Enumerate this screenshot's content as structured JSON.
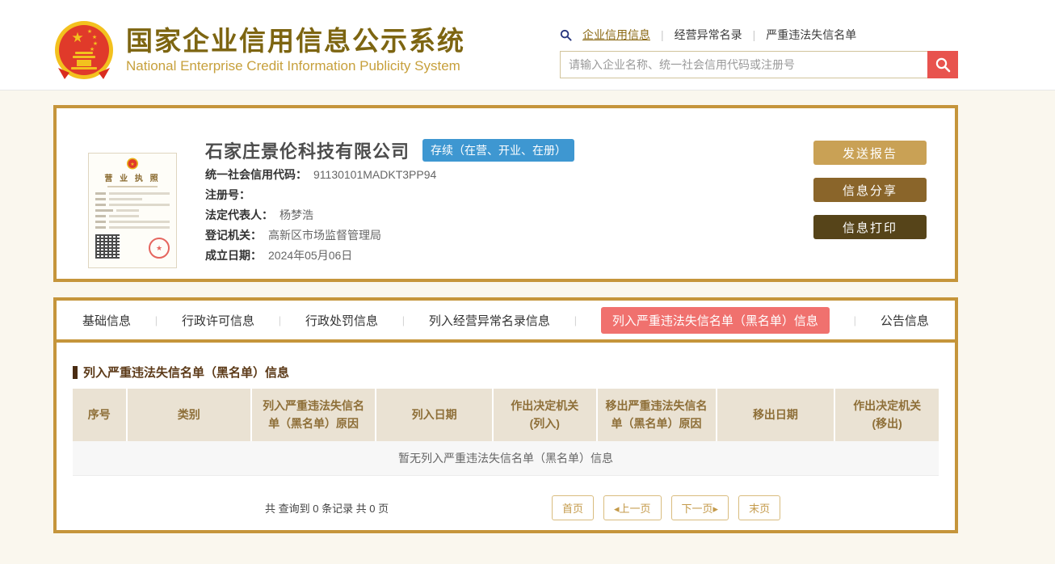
{
  "header": {
    "title_cn": "国家企业信用信息公示系统",
    "title_en": "National Enterprise Credit Information Publicity System",
    "nav": [
      {
        "label": "企业信用信息",
        "active": true
      },
      {
        "label": "经营异常名录",
        "active": false
      },
      {
        "label": "严重违法失信名单",
        "active": false
      }
    ],
    "search": {
      "placeholder": "请输入企业名称、统一社会信用代码或注册号"
    }
  },
  "company": {
    "name": "石家庄景伦科技有限公司",
    "status_badge": "存续（在营、开业、在册）",
    "license_title": "营 业 执 照",
    "fields": [
      {
        "label": "统一社会信用代码：",
        "value": "91130101MADKT3PP94"
      },
      {
        "label": "注册号：",
        "value": ""
      },
      {
        "label": "法定代表人：",
        "value": "杨梦浩"
      },
      {
        "label": "登记机关：",
        "value": "高新区市场监督管理局"
      },
      {
        "label": "成立日期：",
        "value": "2024年05月06日"
      }
    ],
    "actions": [
      {
        "label": "发送报告",
        "color": "#C9A155"
      },
      {
        "label": "信息分享",
        "color": "#8A652A"
      },
      {
        "label": "信息打印",
        "color": "#564419"
      }
    ]
  },
  "tabs": [
    {
      "label": "基础信息",
      "active": false
    },
    {
      "label": "行政许可信息",
      "active": false
    },
    {
      "label": "行政处罚信息",
      "active": false
    },
    {
      "label": "列入经营异常名录信息",
      "active": false
    },
    {
      "label": "列入严重违法失信名单（黑名单）信息",
      "active": true
    },
    {
      "label": "公告信息",
      "active": false
    }
  ],
  "section": {
    "title": "列入严重违法失信名单（黑名单）信息",
    "table": {
      "headers": [
        "序号",
        "类别",
        "列入严重违法失信名\n单（黑名单）原因",
        "列入日期",
        "作出决定机关\n(列入)",
        "移出严重违法失信名\n单（黑名单）原因",
        "移出日期",
        "作出决定机关\n(移出)"
      ],
      "empty_text": "暂无列入严重违法失信名单（黑名单）信息"
    },
    "pagination": {
      "summary": "共 查询到 0 条记录 共 0 页",
      "buttons": [
        "首页",
        "◂上一页",
        "下一页▸",
        "末页"
      ]
    }
  },
  "colors": {
    "gold_border": "#C5953B",
    "active_tab": "#F0716E",
    "badge_blue": "#3E97D1",
    "search_red": "#E8534E"
  }
}
